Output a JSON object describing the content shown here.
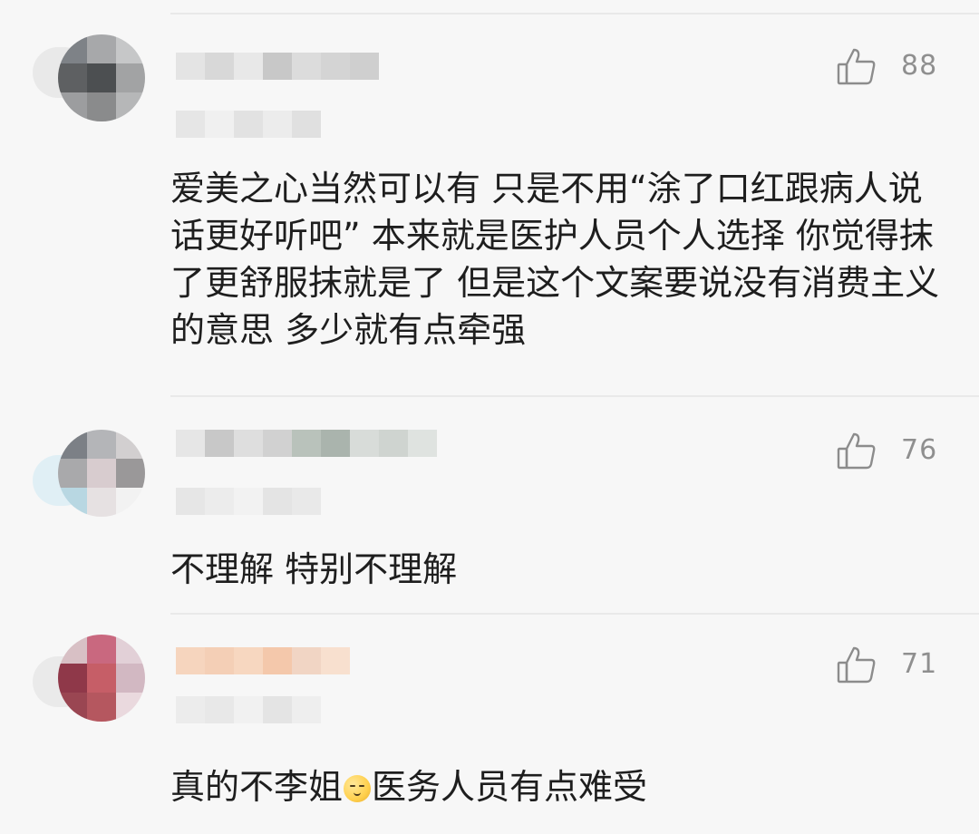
{
  "comments": [
    {
      "like_count": "88",
      "text": "爱美之心当然可以有 只是不用“涂了口红跟病人说话更好听吧” 本来就是医护人员个人选择 你觉得抹了更舒服抹就是了 但是这个文案要说没有消费主义的意思 多少就有点牵强"
    },
    {
      "like_count": "76",
      "text": "不理解 特别不理解"
    },
    {
      "like_count": "71",
      "text_before": "真的不李姐",
      "text_after": "医务人员有点难受"
    }
  ],
  "icons": {
    "like": "thumbs-up-icon",
    "emoji": "emoji-icon"
  },
  "colors": {
    "background": "#f7f7f7",
    "text": "#1e1e1e",
    "meta": "#8f8f8f",
    "divider": "#e9e9e9"
  }
}
